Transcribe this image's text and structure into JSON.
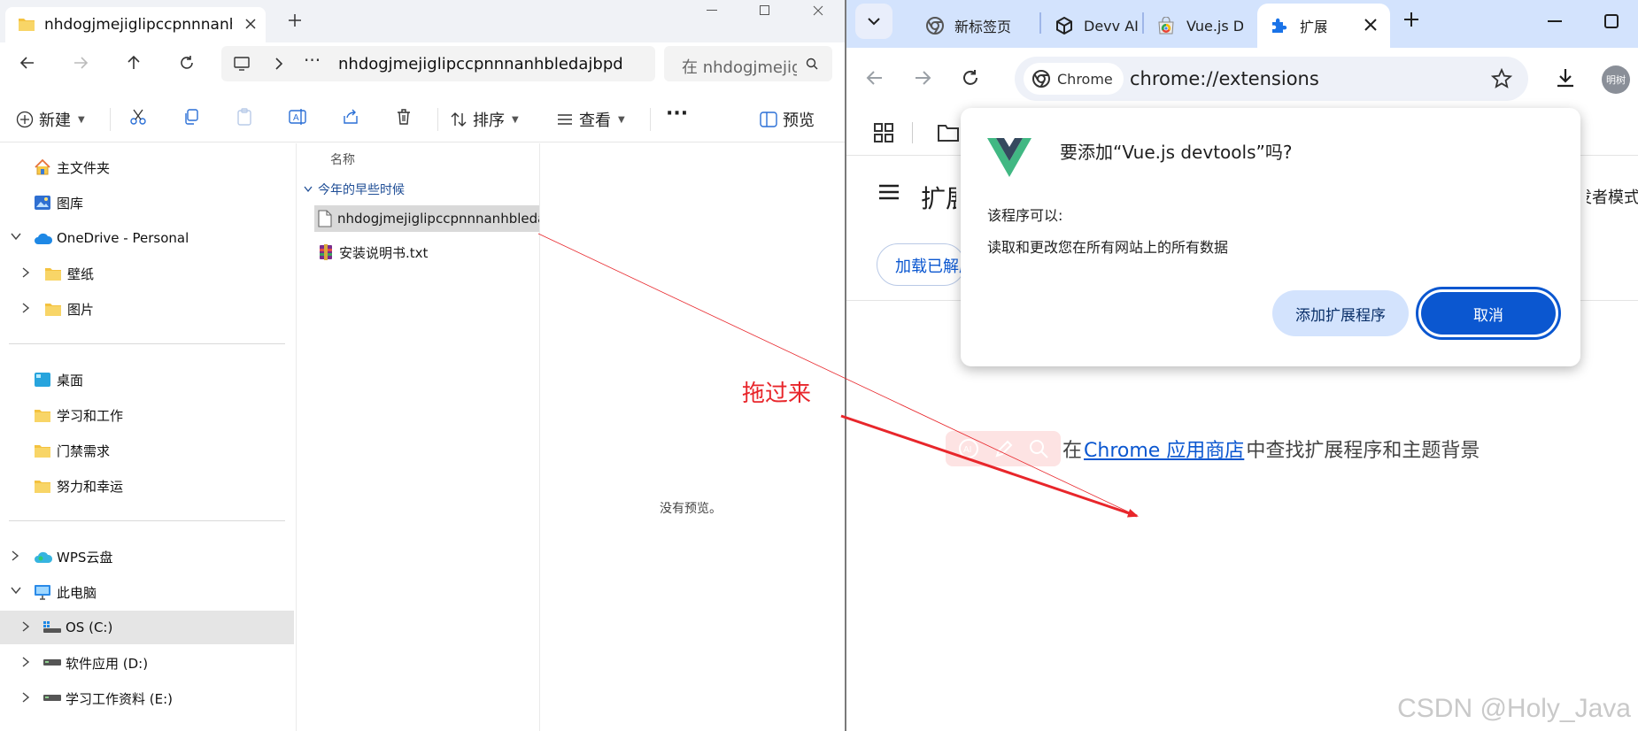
{
  "explorer": {
    "tab_title": "nhdogjmejiglipccpnnnanhbledajbpd",
    "address_path": "nhdogjmejiglipccpnnnanhbledajbpd",
    "address_ellipsis": "···",
    "search_placeholder": "在 nhdogjmejiglipccpnnnanhbledajbpd 中搜索",
    "toolbar": {
      "new_label": "新建",
      "sort_label": "排序",
      "view_label": "查看",
      "more_label": "···",
      "preview_label": "预览"
    },
    "nav_items": [
      {
        "label": "主文件夹",
        "icon": "home-icon"
      },
      {
        "label": "图库",
        "icon": "gallery-icon"
      },
      {
        "label": "OneDrive - Personal",
        "icon": "onedrive-icon"
      },
      {
        "label": "壁纸",
        "icon": "folder-icon"
      },
      {
        "label": "图片",
        "icon": "folder-icon"
      },
      {
        "label": "桌面",
        "icon": "desktop-icon"
      },
      {
        "label": "学习和工作",
        "icon": "folder-icon"
      },
      {
        "label": "门禁需求",
        "icon": "folder-icon"
      },
      {
        "label": "努力和幸运",
        "icon": "folder-icon"
      },
      {
        "label": "WPS云盘",
        "icon": "wps-cloud-icon"
      },
      {
        "label": "此电脑",
        "icon": "pc-icon"
      },
      {
        "label": "OS (C:)",
        "icon": "drive-icon"
      },
      {
        "label": "软件应用 (D:)",
        "icon": "drive-icon"
      },
      {
        "label": "学习工作资料 (E:)",
        "icon": "drive-icon"
      }
    ],
    "column_header": "名称",
    "group_header": "今年的早些时候",
    "files": [
      {
        "name": "nhdogjmejiglipccpnnnanhbledajbpd",
        "icon": "file-icon"
      },
      {
        "name": "安装说明书.txt",
        "icon": "winrar-icon"
      }
    ],
    "preview_message": "没有预览。"
  },
  "chrome": {
    "tabs": [
      {
        "title": "新标签页",
        "icon": "chrome-icon"
      },
      {
        "title": "Devv AI",
        "icon": "devv-icon"
      },
      {
        "title": "Vue.js Devtools",
        "icon": "webstore-icon"
      },
      {
        "title": "扩展程序",
        "icon": "puzzle-icon"
      }
    ],
    "chip_label": "Chrome",
    "url": "chrome://extensions",
    "avatar_label": "明树",
    "page_title": "扩展程序",
    "dev_mode_label": "开发者模式",
    "load_button_label": "加载已解压的扩展程序",
    "store_prefix": "在",
    "store_link": "Chrome 应用商店",
    "store_suffix": "中查找扩展程序和主题背景",
    "watermark": "CSDN @Holy_Java"
  },
  "dialog": {
    "title": "要添加“Vue.js devtools”吗?",
    "subtitle": "该程序可以:",
    "permission": "读取和更改您在所有网站上的所有数据",
    "add_button": "添加扩展程序",
    "cancel_button": "取消"
  },
  "annotation": {
    "text": "拖过来",
    "color": "#e8262b"
  },
  "colors": {
    "chrome_accent": "#0b57d0",
    "chrome_tabstrip": "#d3e3fd",
    "vue_green": "#41b883",
    "vue_dark": "#35495e"
  }
}
